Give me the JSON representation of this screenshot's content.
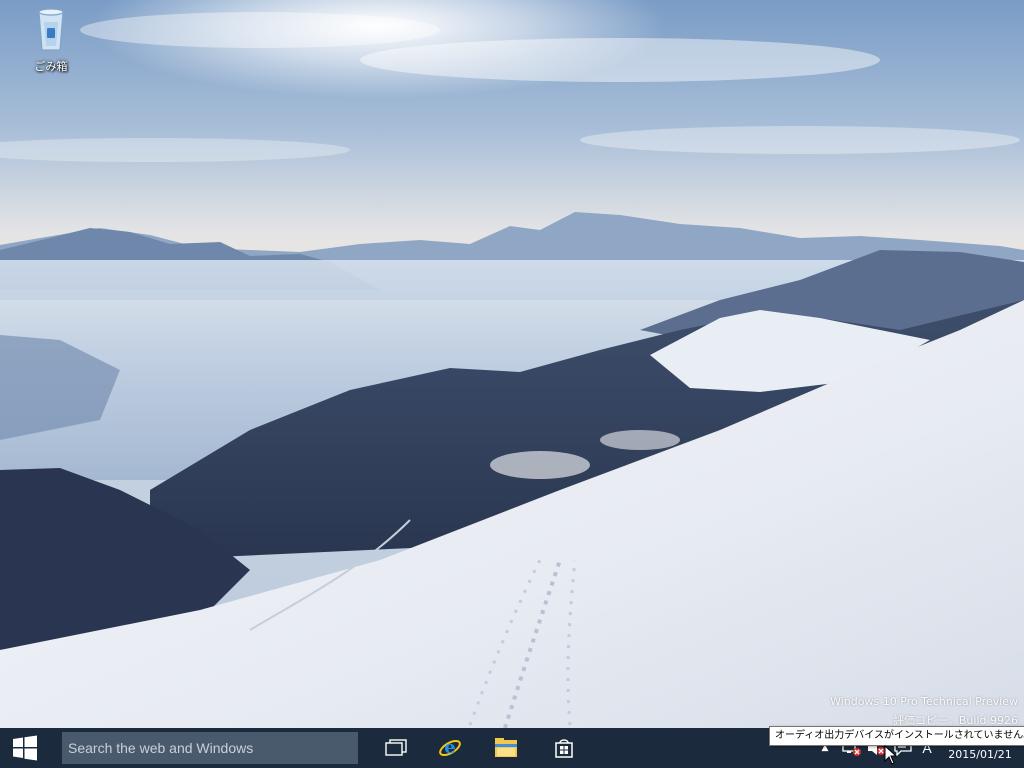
{
  "desktop": {
    "icons": [
      {
        "label": "ごみ箱",
        "icon": "recycle-bin-icon"
      }
    ],
    "watermark": {
      "line1": "Windows 10 Pro Technical Preview",
      "line2": "評価コピー。Build 9926"
    }
  },
  "taskbar": {
    "background": "#1b2a3d",
    "start_icon": "windows-logo-icon",
    "search": {
      "placeholder": "Search the web and Windows",
      "value": ""
    },
    "pinned": [
      {
        "icon": "task-view-icon"
      },
      {
        "icon": "internet-explorer-icon"
      },
      {
        "icon": "file-explorer-icon"
      },
      {
        "icon": "store-icon"
      }
    ],
    "tray": {
      "ime_indicator": "A",
      "tooltip": "オーディオ出力デバイスがインストールされていません。",
      "clock_date": "2015/01/21"
    }
  }
}
